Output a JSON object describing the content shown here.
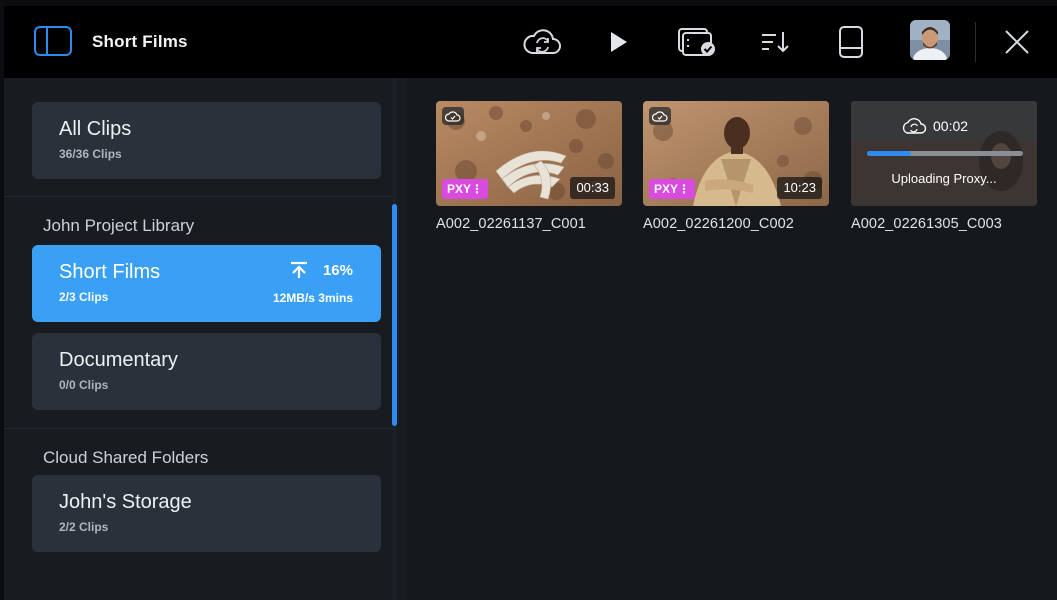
{
  "header": {
    "title": "Short Films",
    "icons": [
      "sidebar-toggle-icon",
      "cloud-sync-icon",
      "play-icon",
      "media-check-icon",
      "sort-icon",
      "storage-icon",
      "avatar",
      "close-icon"
    ]
  },
  "sidebar": {
    "all_clips": {
      "name": "All Clips",
      "count": "36/36 Clips"
    },
    "project_section": "John Project Library",
    "projects": [
      {
        "name": "Short Films",
        "count": "2/3 Clips",
        "upload_percent": "16%",
        "upload_speed": "12MB/s 3mins",
        "active": true
      },
      {
        "name": "Documentary",
        "count": "0/0 Clips",
        "active": false
      }
    ],
    "cloud_section": "Cloud Shared Folders",
    "cloud_folders": [
      {
        "name": "John's Storage",
        "count": "2/2 Clips"
      }
    ]
  },
  "clips": [
    {
      "name": "A002_02261137_C001",
      "badge": "PXY",
      "duration": "00:33"
    },
    {
      "name": "A002_02261200_C002",
      "badge": "PXY",
      "duration": "10:23"
    },
    {
      "name": "A002_02261305_C003",
      "upload_time": "00:02",
      "upload_label": "Uploading Proxy...",
      "progress": 0.28
    }
  ],
  "colors": {
    "accent": "#3aa0f5",
    "pxy_badge": "#d94ae0",
    "card": "#2a313a"
  }
}
